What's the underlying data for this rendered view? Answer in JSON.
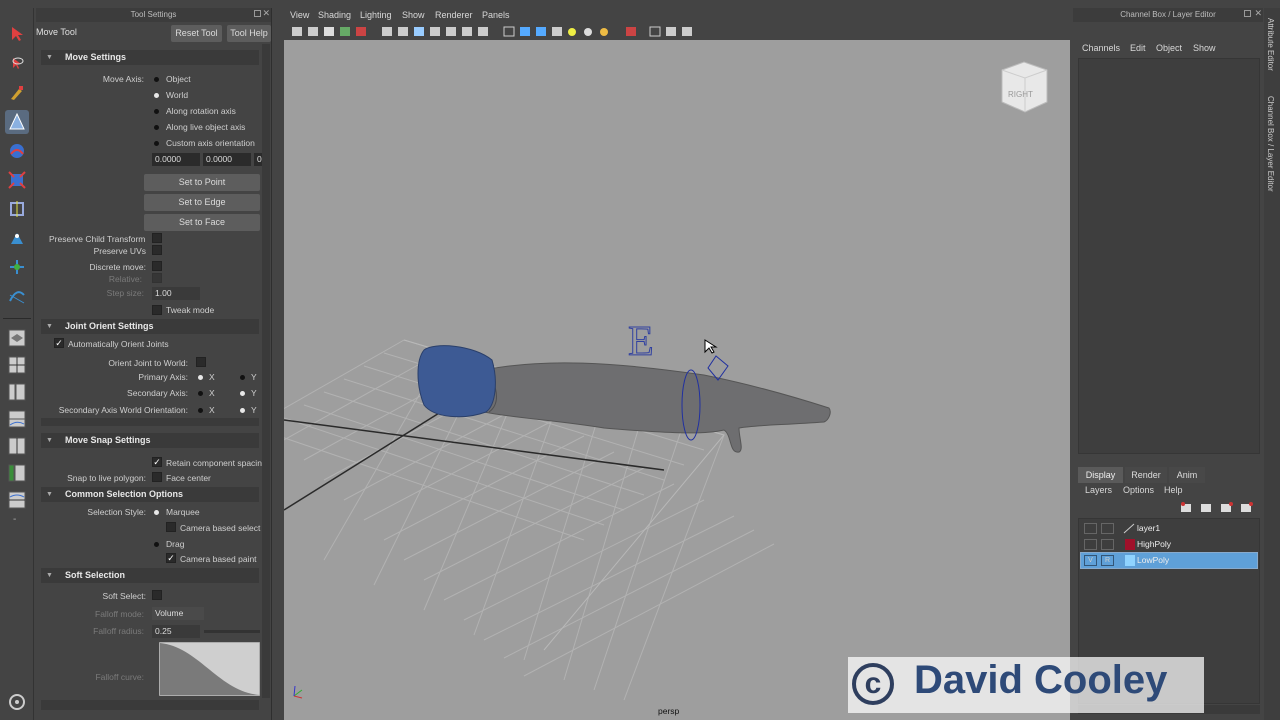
{
  "toolbox": {
    "icons": [
      "select-arrow-icon",
      "lasso-icon",
      "paint-select-icon",
      "move-tool-icon",
      "rotate-tool-icon",
      "scale-tool-icon",
      "manipulator-icon",
      "soft-mod-icon",
      "show-manip-icon",
      "curve-icon",
      "layout-single-icon",
      "layout-four-icon",
      "layout-outliner-icon",
      "layout-graph-icon",
      "layout-persp-icon",
      "layout-tall-icon",
      "layout-extra-icon"
    ]
  },
  "tool_settings": {
    "panel_title": "Tool Settings",
    "tool_name": "Move Tool",
    "reset_label": "Reset Tool",
    "help_label": "Tool Help",
    "move_settings": {
      "title": "Move Settings",
      "move_axis_label": "Move Axis:",
      "axis_options": [
        "Object",
        "World",
        "Along rotation axis",
        "Along live object axis",
        "Custom axis orientation"
      ],
      "selected_axis": "World",
      "field1": "0.0000",
      "field2": "0.0000",
      "field3": "0",
      "set_to_point": "Set to Point",
      "set_to_edge": "Set to Edge",
      "set_to_face": "Set to Face",
      "preserve_child": "Preserve Child Transform",
      "preserve_uvs": "Preserve UVs",
      "discrete_move": "Discrete move:",
      "relative": "Relative:",
      "step_size": "Step size:",
      "step_value": "1.00",
      "tweak_mode": "Tweak mode"
    },
    "joint_orient": {
      "title": "Joint Orient Settings",
      "auto_orient": "Automatically Orient Joints",
      "orient_to_world": "Orient Joint to World:",
      "primary_axis": "Primary Axis:",
      "secondary_axis": "Secondary Axis:",
      "secondary_world": "Secondary Axis World Orientation:",
      "x": "X",
      "y": "Y"
    },
    "move_snap": {
      "title": "Move Snap Settings",
      "retain": "Retain component spacin",
      "snap_label": "Snap to live polygon:",
      "face_center": "Face center"
    },
    "common_selection": {
      "title": "Common Selection Options",
      "style_label": "Selection Style:",
      "marquee": "Marquee",
      "camera_based_select": "Camera based select",
      "drag": "Drag",
      "camera_based_paint": "Camera based paint"
    },
    "soft_selection": {
      "title": "Soft Selection",
      "soft_select": "Soft Select:",
      "falloff_mode": "Falloff mode:",
      "falloff_mode_value": "Volume",
      "falloff_radius": "Falloff radius:",
      "falloff_radius_value": "0.25",
      "falloff_curve": "Falloff curve:"
    }
  },
  "viewport": {
    "menu": [
      "View",
      "Shading",
      "Lighting",
      "Show",
      "Renderer",
      "Panels"
    ],
    "camera_label": "persp",
    "viewcube_label": "RIGHT",
    "manip_letter": "E"
  },
  "channel_box": {
    "panel_title": "Channel Box / Layer Editor",
    "menu": [
      "Channels",
      "Edit",
      "Object",
      "Show"
    ],
    "tabs": [
      "Display",
      "Render",
      "Anim"
    ],
    "active_tab": "Display",
    "layer_menu": [
      "Layers",
      "Options",
      "Help"
    ],
    "layers": [
      {
        "name": "layer1",
        "color": "#444444",
        "v": "",
        "r": ""
      },
      {
        "name": "HighPoly",
        "color": "#a0102a",
        "v": "",
        "r": ""
      },
      {
        "name": "LowPoly",
        "color": "#8fd3ff",
        "v": "V",
        "r": "R"
      }
    ]
  },
  "side_tabs": [
    "Attribute Editor",
    "Channel Box / Layer Editor"
  ],
  "watermark": {
    "text": "David Cooley",
    "symbol": "c"
  }
}
